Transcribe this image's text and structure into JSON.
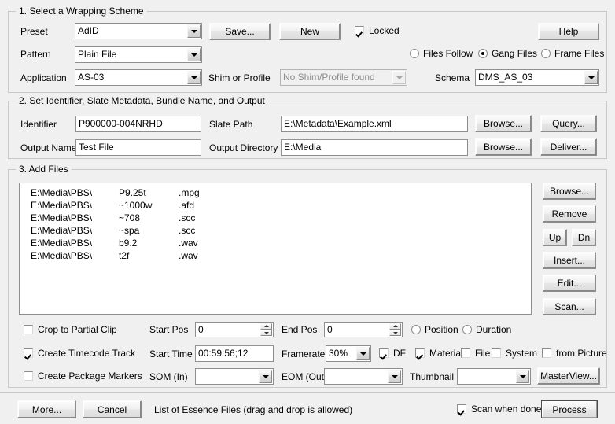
{
  "section1": {
    "title": "1. Select a Wrapping Scheme",
    "preset_label": "Preset",
    "preset_value": "AdID",
    "pattern_label": "Pattern",
    "pattern_value": "Plain File",
    "application_label": "Application",
    "application_value": "AS-03",
    "save_button": "Save...",
    "new_button": "New",
    "locked_label": "Locked",
    "locked_checked": true,
    "help_button": "Help",
    "shim_label": "Shim or Profile",
    "shim_value": "No Shim/Profile found",
    "shim_disabled": true,
    "radios": [
      {
        "label": "Files Follow",
        "selected": false
      },
      {
        "label": "Gang Files",
        "selected": true
      },
      {
        "label": "Frame Files",
        "selected": false
      }
    ],
    "schema_label": "Schema",
    "schema_value": "DMS_AS_03"
  },
  "section2": {
    "title": "2. Set Identifier, Slate Metadata, Bundle Name, and Output",
    "identifier_label": "Identifier",
    "identifier_value": "P900000-004NRHD",
    "output_name_label": "Output Name",
    "output_name_value": "Test File",
    "slate_path_label": "Slate Path",
    "slate_path_value": "E:\\Metadata\\Example.xml",
    "output_dir_label": "Output Directory",
    "output_dir_value": "E:\\Media",
    "browse1_button": "Browse...",
    "browse2_button": "Browse...",
    "query_button": "Query...",
    "deliver_button": "Deliver..."
  },
  "section3": {
    "title": "3. Add Files",
    "files": [
      {
        "path": "E:\\Media\\PBS\\",
        "name": "P9.25t",
        "ext": ".mpg"
      },
      {
        "path": "E:\\Media\\PBS\\",
        "name": "~1000w",
        "ext": ".afd"
      },
      {
        "path": "E:\\Media\\PBS\\",
        "name": "~708",
        "ext": ".scc"
      },
      {
        "path": "E:\\Media\\PBS\\",
        "name": "~spa",
        "ext": ".scc"
      },
      {
        "path": "E:\\Media\\PBS\\",
        "name": "b9.2",
        "ext": ".wav"
      },
      {
        "path": "E:\\Media\\PBS\\",
        "name": "t2f",
        "ext": ".wav"
      }
    ],
    "browse_button": "Browse...",
    "remove_button": "Remove",
    "up_button": "Up",
    "dn_button": "Dn",
    "insert_button": "Insert...",
    "edit_button": "Edit...",
    "scan_button": "Scan...",
    "crop_label": "Crop to Partial Clip",
    "crop_checked": false,
    "timecode_label": "Create Timecode Track",
    "timecode_checked": true,
    "markers_label": "Create Package Markers",
    "markers_checked": false,
    "start_pos_label": "Start Pos",
    "start_pos_value": "0",
    "end_pos_label": "End Pos",
    "end_pos_value": "0",
    "position_label": "Position",
    "position_selected": false,
    "duration_label": "Duration",
    "duration_selected": false,
    "start_time_label": "Start Time",
    "start_time_value": "00:59:56;12",
    "framerate_label": "Framerate",
    "framerate_value": "30%",
    "df_label": "DF",
    "df_checked": true,
    "material_label": "Material",
    "material_checked": true,
    "file_label": "File",
    "file_checked": false,
    "system_label": "System",
    "system_checked": false,
    "from_picture_label": "from Picture",
    "from_picture_checked": false,
    "som_label": "SOM (In)",
    "som_value": "",
    "eom_label": "EOM (Out)",
    "eom_value": "",
    "thumbnail_label": "Thumbnail",
    "thumbnail_value": "",
    "masterview_button": "MasterView..."
  },
  "footer": {
    "more_button": "More...",
    "cancel_button": "Cancel",
    "status_text": "List of Essence Files (drag and drop is allowed)",
    "scan_when_done_label": "Scan when done",
    "scan_when_done_checked": true,
    "process_button": "Process"
  }
}
